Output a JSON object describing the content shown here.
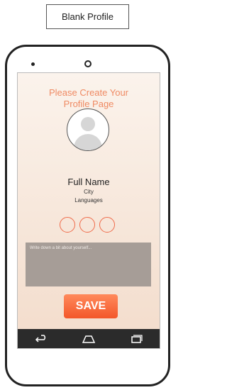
{
  "caption": "Blank Profile",
  "profile": {
    "headline": "Please Create Your Profile Page",
    "full_name": "Full Name",
    "city": "City",
    "languages": "Languages",
    "bio_placeholder": "Write down a bit about yourself...",
    "save_label": "SAVE"
  },
  "navbar": {
    "icons": [
      "back-icon",
      "home-icon",
      "recent-apps-icon"
    ]
  },
  "colors": {
    "accent": "#ef8a63",
    "save_button": "#f3572a",
    "bio_background": "#a69d97",
    "navbar": "#2b2b2b"
  }
}
